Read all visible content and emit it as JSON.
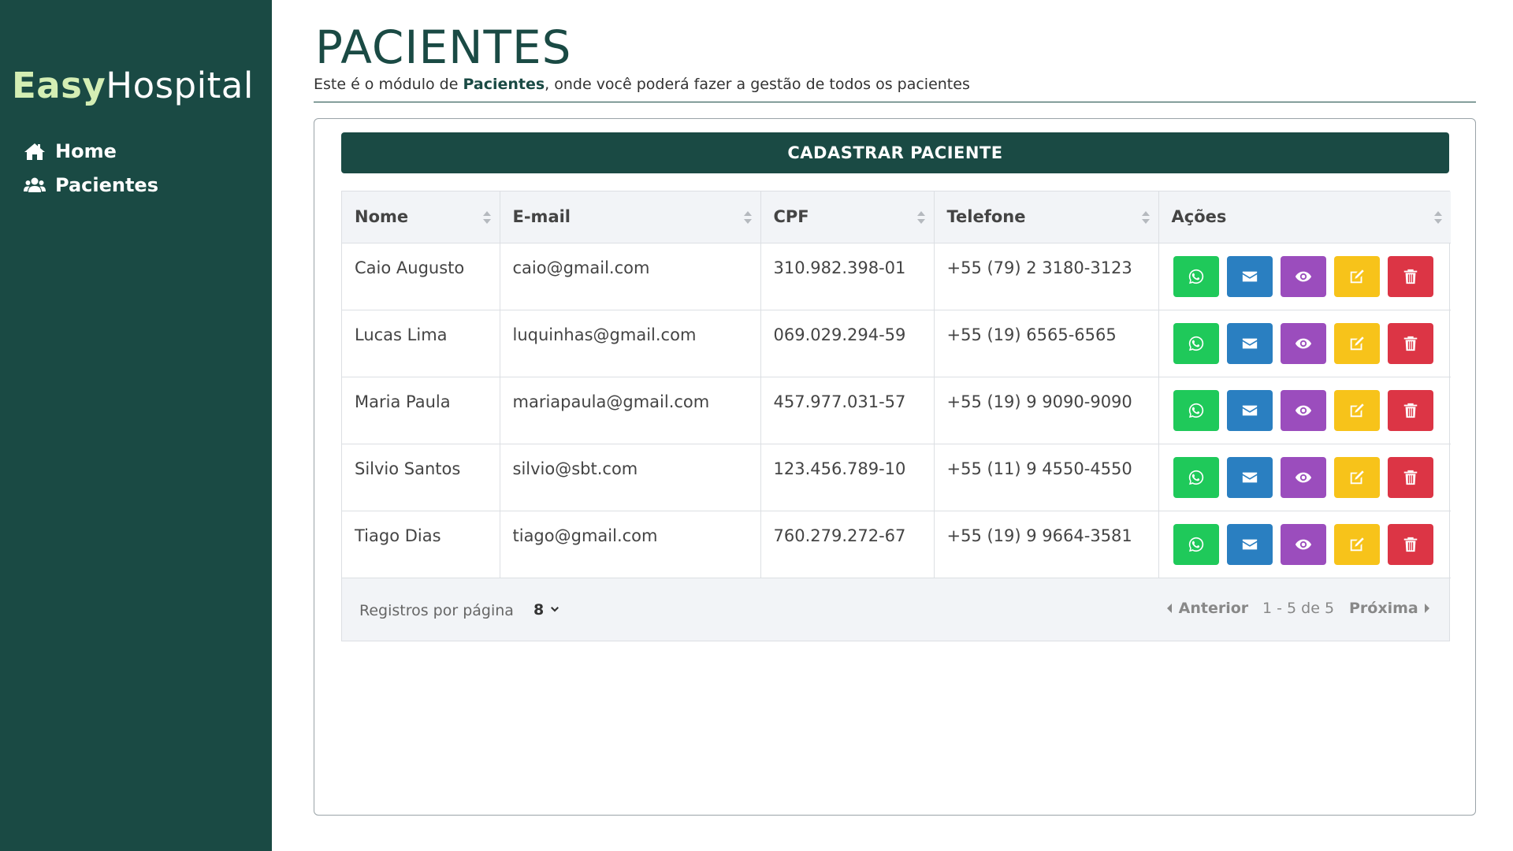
{
  "brand": {
    "strong": "Easy",
    "light": "Hospital"
  },
  "nav": {
    "items": [
      {
        "label": "Home",
        "icon": "home-icon"
      },
      {
        "label": "Pacientes",
        "icon": "users-icon"
      }
    ]
  },
  "header": {
    "title": "PACIENTES",
    "subtitle_prefix": "Este é o módulo de ",
    "subtitle_strong": "Pacientes",
    "subtitle_suffix": ", onde você poderá fazer a gestão de todos os pacientes"
  },
  "toolbar": {
    "add_label": "CADASTRAR PACIENTE"
  },
  "table": {
    "columns": [
      "Nome",
      "E-mail",
      "CPF",
      "Telefone",
      "Ações"
    ],
    "rows": [
      {
        "nome": "Caio Augusto",
        "email": "caio@gmail.com",
        "cpf": "310.982.398-01",
        "telefone": "+55 (79) 2 3180-3123"
      },
      {
        "nome": "Lucas Lima",
        "email": "luquinhas@gmail.com",
        "cpf": "069.029.294-59",
        "telefone": "+55 (19) 6565-6565"
      },
      {
        "nome": "Maria Paula",
        "email": "mariapaula@gmail.com",
        "cpf": "457.977.031-57",
        "telefone": "+55 (19) 9 9090-9090"
      },
      {
        "nome": "Silvio Santos",
        "email": "silvio@sbt.com",
        "cpf": "123.456.789-10",
        "telefone": "+55 (11) 9 4550-4550"
      },
      {
        "nome": "Tiago Dias",
        "email": "tiago@gmail.com",
        "cpf": "760.279.272-67",
        "telefone": "+55 (19) 9 9664-3581"
      }
    ],
    "action_icons": [
      "whatsapp-icon",
      "envelope-icon",
      "eye-icon",
      "edit-icon",
      "trash-icon"
    ]
  },
  "pagination": {
    "rows_per_page_label": "Registros por página",
    "rows_per_page_value": "8",
    "prev_label": "Anterior",
    "info": "1 - 5 de 5",
    "next_label": "Próxima"
  },
  "colors": {
    "brand": "#1a4a44",
    "brand_accent": "#d4eeb4",
    "whatsapp": "#1fc95a",
    "email": "#2a7fc1",
    "view": "#9b4dbd",
    "edit": "#f7c31a",
    "delete": "#dc3545"
  }
}
